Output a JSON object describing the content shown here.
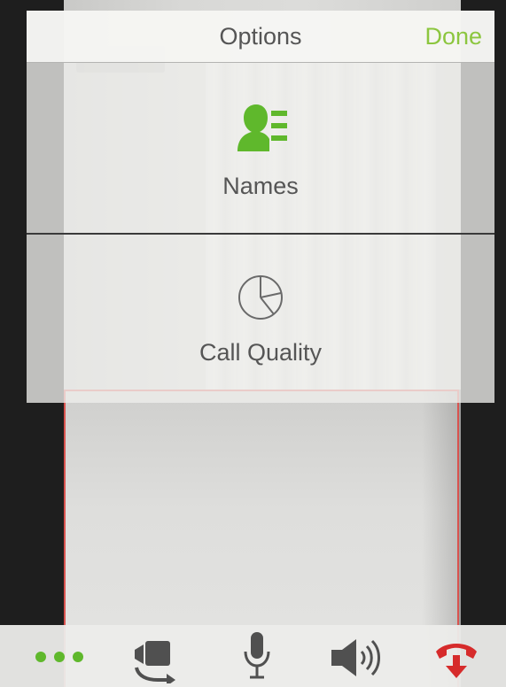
{
  "options": {
    "title": "Options",
    "done_label": "Done",
    "items": [
      {
        "label": "Names",
        "icon": "names-icon"
      },
      {
        "label": "Call Quality",
        "icon": "call-quality-icon"
      }
    ]
  },
  "toolbar": {
    "buttons": [
      {
        "icon": "more-options-icon"
      },
      {
        "icon": "switch-camera-icon"
      },
      {
        "icon": "microphone-icon"
      },
      {
        "icon": "speaker-icon"
      },
      {
        "icon": "end-call-icon"
      }
    ]
  },
  "colors": {
    "accent_green": "#8cc63f",
    "end_call_red": "#d62b2b",
    "icon_gray": "#555555",
    "preview_border": "#d9534f"
  }
}
